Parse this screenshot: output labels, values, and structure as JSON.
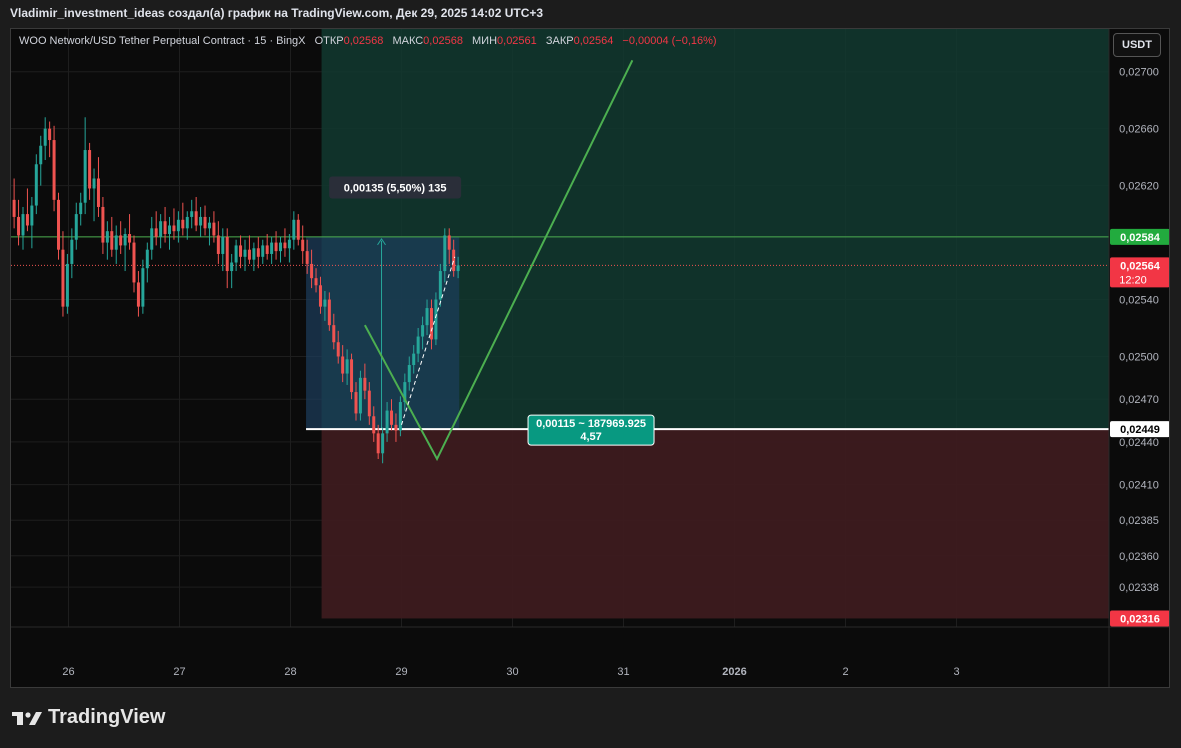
{
  "header": {
    "author_line": "Vladimir_investment_ideas создал(а) график на TradingView.com, Дек 29, 2025 14:02 UTC+3"
  },
  "legend": {
    "symbol": "WOO Network/USD Tether Perpetual Contract · 15 · BingX",
    "open_label": "ОТКР",
    "open": "0,02568",
    "high_label": "МАКС",
    "high": "0,02568",
    "low_label": "МИН",
    "low": "0,02561",
    "close_label": "ЗАКР",
    "close": "0,02564",
    "change": "−0,00004 (−0,16%)"
  },
  "currency": "USDT",
  "colors": {
    "up": "#26a69a",
    "down": "#ef5350",
    "accent_line": "#4caf50",
    "target_zone": "#123a30",
    "stop_zone": "#3d1b1f",
    "measure_zone": "#1d3d5c",
    "price_red": "#f23645",
    "price_green": "#22ab3e",
    "position_label": "#089981"
  },
  "footer": {
    "logo_text": "TradingView",
    "logo_icon": "tradingview-logo-icon"
  },
  "chart_data": {
    "type": "candlestick",
    "symbol": "WOO/USDT",
    "interval": "15",
    "x_ticks": [
      "26",
      "27",
      "28",
      "29",
      "30",
      "31",
      "2026",
      "2",
      "3"
    ],
    "y_ticks": [
      "0,02700",
      "0,02660",
      "0,02620",
      "0,02540",
      "0,02500",
      "0,02470",
      "0,02440",
      "0,02410",
      "0,02385",
      "0,02360",
      "0,02338"
    ],
    "ylim": [
      0.0231,
      0.0273
    ],
    "price_labels": {
      "target": "0,02584",
      "last": "0,02564",
      "countdown": "12:20",
      "entry": "0,02449",
      "stop": "0,02316"
    },
    "levels": {
      "target": 0.02584,
      "last": 0.02564,
      "entry": 0.02449,
      "stop": 0.02316
    },
    "measure_label": "0,00135 (5,50%) 135",
    "position_label": {
      "line1": "0,00115 ~ 187969.925",
      "line2": "4,57"
    },
    "drawn_path": [
      {
        "day": 28.67,
        "price": 0.02522
      },
      {
        "day": 29.32,
        "price": 0.02428
      },
      {
        "day": 31.08,
        "price": 0.02708
      }
    ],
    "candles": [
      {
        "day": 25.51,
        "open": 0.0261,
        "high": 0.02625,
        "low": 0.0259,
        "close": 0.02598
      },
      {
        "day": 25.55,
        "open": 0.02598,
        "high": 0.0261,
        "low": 0.02578,
        "close": 0.02585
      },
      {
        "day": 25.59,
        "open": 0.02585,
        "high": 0.02605,
        "low": 0.02575,
        "close": 0.026
      },
      {
        "day": 25.63,
        "open": 0.026,
        "high": 0.02618,
        "low": 0.02588,
        "close": 0.02592
      },
      {
        "day": 25.67,
        "open": 0.02592,
        "high": 0.02612,
        "low": 0.02576,
        "close": 0.02606
      },
      {
        "day": 25.71,
        "open": 0.02606,
        "high": 0.02642,
        "low": 0.026,
        "close": 0.02635
      },
      {
        "day": 25.75,
        "open": 0.02635,
        "high": 0.02655,
        "low": 0.0262,
        "close": 0.02648
      },
      {
        "day": 25.79,
        "open": 0.02648,
        "high": 0.02668,
        "low": 0.02638,
        "close": 0.0266
      },
      {
        "day": 25.83,
        "open": 0.0266,
        "high": 0.02665,
        "low": 0.0264,
        "close": 0.02652
      },
      {
        "day": 25.87,
        "open": 0.02652,
        "high": 0.02662,
        "low": 0.02602,
        "close": 0.0261
      },
      {
        "day": 25.91,
        "open": 0.0261,
        "high": 0.02615,
        "low": 0.02568,
        "close": 0.02575
      },
      {
        "day": 25.95,
        "open": 0.02575,
        "high": 0.02588,
        "low": 0.02528,
        "close": 0.02535
      },
      {
        "day": 25.99,
        "open": 0.02535,
        "high": 0.02572,
        "low": 0.0253,
        "close": 0.02565
      },
      {
        "day": 26.03,
        "open": 0.02565,
        "high": 0.0259,
        "low": 0.02555,
        "close": 0.02582
      },
      {
        "day": 26.07,
        "open": 0.02582,
        "high": 0.02608,
        "low": 0.02575,
        "close": 0.026
      },
      {
        "day": 26.11,
        "open": 0.026,
        "high": 0.02615,
        "low": 0.02592,
        "close": 0.02608
      },
      {
        "day": 26.15,
        "open": 0.02608,
        "high": 0.02668,
        "low": 0.026,
        "close": 0.02645
      },
      {
        "day": 26.19,
        "open": 0.02645,
        "high": 0.0265,
        "low": 0.0261,
        "close": 0.02618
      },
      {
        "day": 26.23,
        "open": 0.02618,
        "high": 0.02632,
        "low": 0.02595,
        "close": 0.02625
      },
      {
        "day": 26.27,
        "open": 0.02625,
        "high": 0.0264,
        "low": 0.02598,
        "close": 0.02605
      },
      {
        "day": 26.31,
        "open": 0.02605,
        "high": 0.02612,
        "low": 0.02572,
        "close": 0.0258
      },
      {
        "day": 26.35,
        "open": 0.0258,
        "high": 0.02595,
        "low": 0.02568,
        "close": 0.02588
      },
      {
        "day": 26.39,
        "open": 0.02588,
        "high": 0.02598,
        "low": 0.0257,
        "close": 0.02575
      },
      {
        "day": 26.43,
        "open": 0.02575,
        "high": 0.02592,
        "low": 0.02565,
        "close": 0.02585
      },
      {
        "day": 26.47,
        "open": 0.02585,
        "high": 0.02595,
        "low": 0.02572,
        "close": 0.02578
      },
      {
        "day": 26.51,
        "open": 0.02578,
        "high": 0.0259,
        "low": 0.0256,
        "close": 0.02586
      },
      {
        "day": 26.55,
        "open": 0.02586,
        "high": 0.026,
        "low": 0.02575,
        "close": 0.0258
      },
      {
        "day": 26.59,
        "open": 0.0258,
        "high": 0.02585,
        "low": 0.02545,
        "close": 0.02552
      },
      {
        "day": 26.63,
        "open": 0.02552,
        "high": 0.0256,
        "low": 0.02528,
        "close": 0.02535
      },
      {
        "day": 26.67,
        "open": 0.02535,
        "high": 0.02568,
        "low": 0.0253,
        "close": 0.02562
      },
      {
        "day": 26.71,
        "open": 0.02562,
        "high": 0.0258,
        "low": 0.02552,
        "close": 0.02575
      },
      {
        "day": 26.75,
        "open": 0.02575,
        "high": 0.02598,
        "low": 0.02568,
        "close": 0.0259
      },
      {
        "day": 26.79,
        "open": 0.0259,
        "high": 0.02602,
        "low": 0.02578,
        "close": 0.02584
      },
      {
        "day": 26.83,
        "open": 0.02584,
        "high": 0.026,
        "low": 0.02576,
        "close": 0.02595
      },
      {
        "day": 26.87,
        "open": 0.02595,
        "high": 0.02605,
        "low": 0.0258,
        "close": 0.02586
      },
      {
        "day": 26.91,
        "open": 0.02586,
        "high": 0.02598,
        "low": 0.02575,
        "close": 0.02592
      },
      {
        "day": 26.95,
        "open": 0.02592,
        "high": 0.02604,
        "low": 0.02582,
        "close": 0.02588
      },
      {
        "day": 26.99,
        "open": 0.02588,
        "high": 0.02602,
        "low": 0.0258,
        "close": 0.02596
      },
      {
        "day": 27.03,
        "open": 0.02596,
        "high": 0.02608,
        "low": 0.02585,
        "close": 0.0259
      },
      {
        "day": 27.07,
        "open": 0.0259,
        "high": 0.02602,
        "low": 0.02582,
        "close": 0.02598
      },
      {
        "day": 27.11,
        "open": 0.02598,
        "high": 0.0261,
        "low": 0.0259,
        "close": 0.02602
      },
      {
        "day": 27.15,
        "open": 0.02602,
        "high": 0.02612,
        "low": 0.02588,
        "close": 0.02592
      },
      {
        "day": 27.19,
        "open": 0.02592,
        "high": 0.02605,
        "low": 0.02584,
        "close": 0.02598
      },
      {
        "day": 27.23,
        "open": 0.02598,
        "high": 0.02606,
        "low": 0.02585,
        "close": 0.0259
      },
      {
        "day": 27.27,
        "open": 0.0259,
        "high": 0.02598,
        "low": 0.02578,
        "close": 0.02594
      },
      {
        "day": 27.31,
        "open": 0.02594,
        "high": 0.02602,
        "low": 0.0258,
        "close": 0.02585
      },
      {
        "day": 27.35,
        "open": 0.02585,
        "high": 0.02595,
        "low": 0.02565,
        "close": 0.02572
      },
      {
        "day": 27.39,
        "open": 0.02572,
        "high": 0.0259,
        "low": 0.0256,
        "close": 0.02584
      },
      {
        "day": 27.43,
        "open": 0.02584,
        "high": 0.0259,
        "low": 0.02548,
        "close": 0.0256
      },
      {
        "day": 27.47,
        "open": 0.0256,
        "high": 0.02572,
        "low": 0.02548,
        "close": 0.02566
      },
      {
        "day": 27.51,
        "open": 0.02566,
        "high": 0.02582,
        "low": 0.0256,
        "close": 0.02578
      },
      {
        "day": 27.55,
        "open": 0.02578,
        "high": 0.02585,
        "low": 0.02562,
        "close": 0.0257
      },
      {
        "day": 27.59,
        "open": 0.0257,
        "high": 0.02582,
        "low": 0.0256,
        "close": 0.02575
      },
      {
        "day": 27.63,
        "open": 0.02575,
        "high": 0.02585,
        "low": 0.02565,
        "close": 0.02568
      },
      {
        "day": 27.67,
        "open": 0.02568,
        "high": 0.0258,
        "low": 0.0256,
        "close": 0.02576
      },
      {
        "day": 27.71,
        "open": 0.02576,
        "high": 0.02584,
        "low": 0.02562,
        "close": 0.0257
      },
      {
        "day": 27.75,
        "open": 0.0257,
        "high": 0.02582,
        "low": 0.02565,
        "close": 0.02578
      },
      {
        "day": 27.79,
        "open": 0.02578,
        "high": 0.02586,
        "low": 0.02568,
        "close": 0.02572
      },
      {
        "day": 27.83,
        "open": 0.02572,
        "high": 0.02584,
        "low": 0.02565,
        "close": 0.0258
      },
      {
        "day": 27.87,
        "open": 0.0258,
        "high": 0.02588,
        "low": 0.02568,
        "close": 0.02574
      },
      {
        "day": 27.91,
        "open": 0.02574,
        "high": 0.02584,
        "low": 0.02566,
        "close": 0.0258
      },
      {
        "day": 27.95,
        "open": 0.0258,
        "high": 0.0259,
        "low": 0.0257,
        "close": 0.02576
      },
      {
        "day": 27.99,
        "open": 0.02576,
        "high": 0.02586,
        "low": 0.02566,
        "close": 0.02582
      },
      {
        "day": 28.03,
        "open": 0.02582,
        "high": 0.02602,
        "low": 0.02575,
        "close": 0.02596
      },
      {
        "day": 28.07,
        "open": 0.02596,
        "high": 0.026,
        "low": 0.02578,
        "close": 0.02582
      },
      {
        "day": 28.11,
        "open": 0.02582,
        "high": 0.02592,
        "low": 0.02565,
        "close": 0.02574
      },
      {
        "day": 28.15,
        "open": 0.02574,
        "high": 0.02582,
        "low": 0.02558,
        "close": 0.02565
      },
      {
        "day": 28.19,
        "open": 0.02565,
        "high": 0.02575,
        "low": 0.02548,
        "close": 0.02555
      },
      {
        "day": 28.23,
        "open": 0.02555,
        "high": 0.02562,
        "low": 0.02545,
        "close": 0.0255
      },
      {
        "day": 28.27,
        "open": 0.0255,
        "high": 0.02556,
        "low": 0.0253,
        "close": 0.02535
      },
      {
        "day": 28.31,
        "open": 0.02535,
        "high": 0.02546,
        "low": 0.02525,
        "close": 0.0254
      },
      {
        "day": 28.35,
        "open": 0.0254,
        "high": 0.02545,
        "low": 0.02518,
        "close": 0.02522
      },
      {
        "day": 28.39,
        "open": 0.02522,
        "high": 0.0253,
        "low": 0.02505,
        "close": 0.0251
      },
      {
        "day": 28.43,
        "open": 0.0251,
        "high": 0.02518,
        "low": 0.02495,
        "close": 0.025
      },
      {
        "day": 28.47,
        "open": 0.025,
        "high": 0.02508,
        "low": 0.02482,
        "close": 0.02488
      },
      {
        "day": 28.51,
        "open": 0.02488,
        "high": 0.02505,
        "low": 0.0248,
        "close": 0.02498
      },
      {
        "day": 28.55,
        "open": 0.02498,
        "high": 0.02502,
        "low": 0.0247,
        "close": 0.02475
      },
      {
        "day": 28.59,
        "open": 0.02475,
        "high": 0.02482,
        "low": 0.02455,
        "close": 0.0246
      },
      {
        "day": 28.63,
        "open": 0.0246,
        "high": 0.0249,
        "low": 0.02455,
        "close": 0.02485
      },
      {
        "day": 28.67,
        "open": 0.02485,
        "high": 0.02495,
        "low": 0.0247,
        "close": 0.02476
      },
      {
        "day": 28.71,
        "open": 0.02476,
        "high": 0.02482,
        "low": 0.02452,
        "close": 0.02458
      },
      {
        "day": 28.75,
        "open": 0.02458,
        "high": 0.02465,
        "low": 0.0244,
        "close": 0.02446
      },
      {
        "day": 28.79,
        "open": 0.02446,
        "high": 0.02452,
        "low": 0.02428,
        "close": 0.02432
      },
      {
        "day": 28.83,
        "open": 0.02432,
        "high": 0.0245,
        "low": 0.02425,
        "close": 0.02446
      },
      {
        "day": 28.87,
        "open": 0.02446,
        "high": 0.02468,
        "low": 0.0244,
        "close": 0.02462
      },
      {
        "day": 28.91,
        "open": 0.02462,
        "high": 0.0247,
        "low": 0.02448,
        "close": 0.02452
      },
      {
        "day": 28.95,
        "open": 0.02452,
        "high": 0.0246,
        "low": 0.0244,
        "close": 0.02448
      },
      {
        "day": 28.99,
        "open": 0.02448,
        "high": 0.02472,
        "low": 0.02444,
        "close": 0.02468
      },
      {
        "day": 29.03,
        "open": 0.02468,
        "high": 0.02488,
        "low": 0.02462,
        "close": 0.02482
      },
      {
        "day": 29.07,
        "open": 0.02482,
        "high": 0.025,
        "low": 0.02476,
        "close": 0.02494
      },
      {
        "day": 29.11,
        "open": 0.02494,
        "high": 0.02508,
        "low": 0.02488,
        "close": 0.02502
      },
      {
        "day": 29.15,
        "open": 0.02502,
        "high": 0.0252,
        "low": 0.02496,
        "close": 0.02514
      },
      {
        "day": 29.19,
        "open": 0.02514,
        "high": 0.02528,
        "low": 0.02505,
        "close": 0.02522
      },
      {
        "day": 29.23,
        "open": 0.02522,
        "high": 0.0254,
        "low": 0.02515,
        "close": 0.02534
      },
      {
        "day": 29.27,
        "open": 0.02534,
        "high": 0.0254,
        "low": 0.02505,
        "close": 0.02512
      },
      {
        "day": 29.31,
        "open": 0.02512,
        "high": 0.02545,
        "low": 0.02508,
        "close": 0.0254
      },
      {
        "day": 29.35,
        "open": 0.0254,
        "high": 0.02565,
        "low": 0.02535,
        "close": 0.0256
      },
      {
        "day": 29.39,
        "open": 0.0256,
        "high": 0.0259,
        "low": 0.02552,
        "close": 0.02585
      },
      {
        "day": 29.43,
        "open": 0.02585,
        "high": 0.0259,
        "low": 0.02565,
        "close": 0.02575
      },
      {
        "day": 29.47,
        "open": 0.02575,
        "high": 0.02582,
        "low": 0.02556,
        "close": 0.0256
      },
      {
        "day": 29.51,
        "open": 0.0256,
        "high": 0.0257,
        "low": 0.02555,
        "close": 0.02564
      }
    ]
  }
}
